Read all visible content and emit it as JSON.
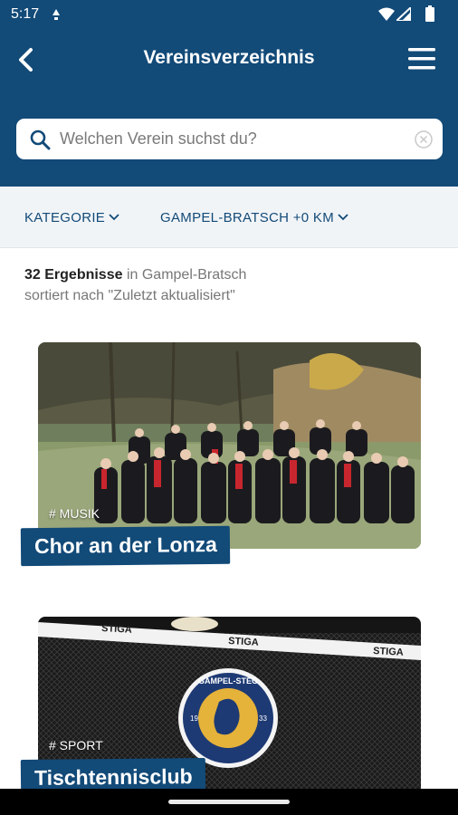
{
  "status_bar": {
    "time": "5:17"
  },
  "header": {
    "title": "Vereinsverzeichnis",
    "bg_color": "#124a78"
  },
  "search": {
    "placeholder": "Welchen Verein suchst du?",
    "value": ""
  },
  "filters": {
    "category_label": "KATEGORIE",
    "location_label": "GAMPEL-BRATSCH +0 KM"
  },
  "results": {
    "count_text": "32 Ergebnisse",
    "location_text": " in Gampel-Bratsch",
    "sort_text": "sortiert nach \"Zuletzt aktualisiert\""
  },
  "clubs": [
    {
      "tag": "# MUSIK",
      "name": "Chor an der Lonza"
    },
    {
      "tag": "# SPORT",
      "name": "Tischtennisclub",
      "logo": {
        "top": "GAMPEL-STEG",
        "left": "19",
        "right": "33"
      }
    }
  ],
  "colors": {
    "accent": "#124a78",
    "filter_bg": "#f1f4f7"
  },
  "icons": [
    "back-arrow-icon",
    "menu-icon",
    "search-icon",
    "clear-icon",
    "chevron-down-icon",
    "wifi-icon",
    "signal-icon",
    "battery-icon",
    "alert-icon"
  ]
}
